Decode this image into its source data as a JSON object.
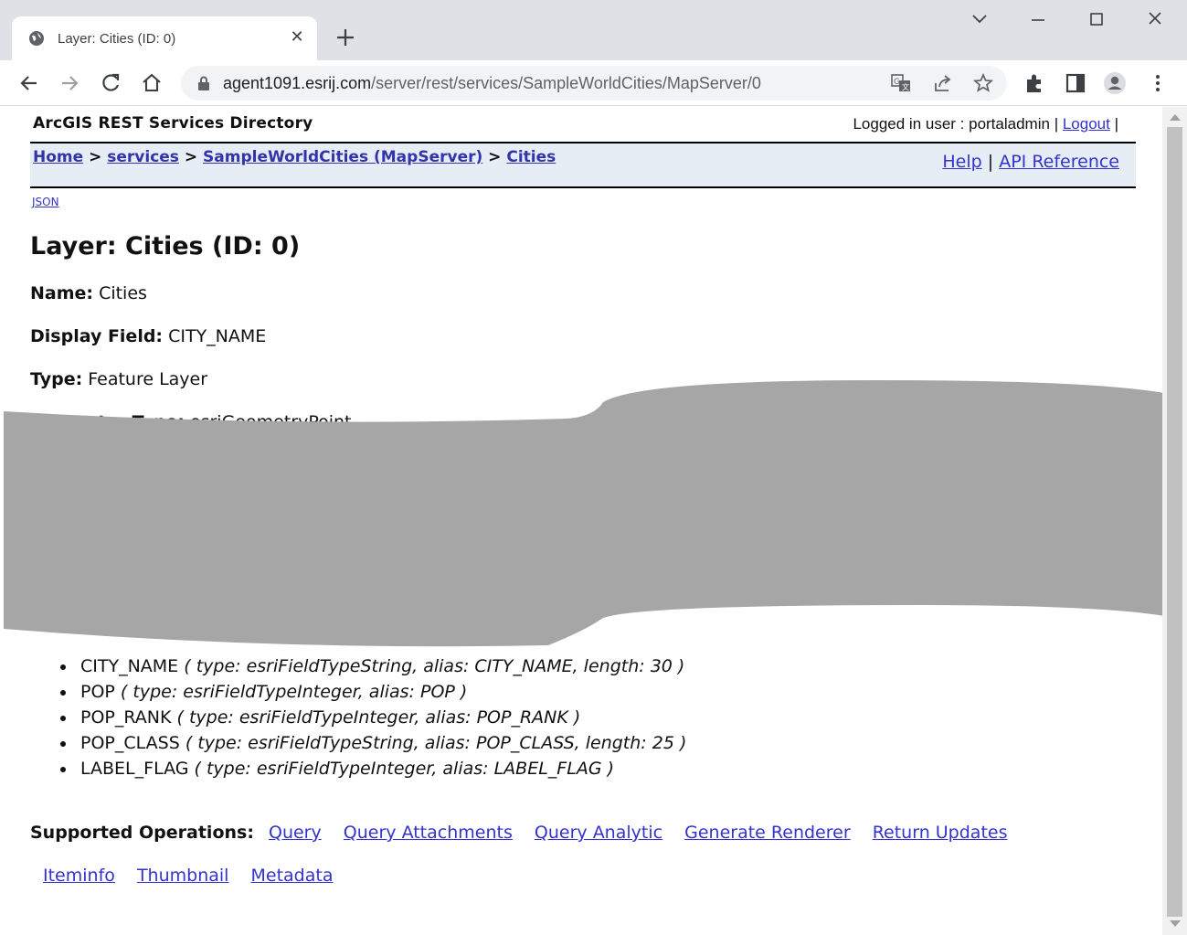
{
  "browser": {
    "tab_title": "Layer: Cities (ID: 0)",
    "url_host": "agent1091.esrij.com",
    "url_path": "/server/rest/services/SampleWorldCities/MapServer/0"
  },
  "header": {
    "directory_title": "ArcGIS REST Services Directory",
    "logged_in_label": "Logged in user : portaladmin",
    "logout_label": "Logout",
    "pipe": "|"
  },
  "breadcrumb": {
    "home": "Home",
    "services": "services",
    "mapserver": "SampleWorldCities (MapServer)",
    "layer": "Cities",
    "sep": ">"
  },
  "help_links": {
    "help": "Help",
    "api_reference": "API Reference",
    "sep": "|"
  },
  "json_link": "JSON",
  "layer": {
    "heading": "Layer: Cities (ID: 0)",
    "name_label": "Name:",
    "name_value": "Cities",
    "display_field_label": "Display Field:",
    "display_field_value": "CITY_NAME",
    "type_label": "Type:",
    "type_value": "Feature Layer",
    "geometry_type_label": "Geometry Type:",
    "geometry_type_value": "esriGeometryPoint"
  },
  "fields": [
    {
      "name": "CITY_NAME",
      "detail": "( type: esriFieldTypeString, alias: CITY_NAME, length: 30 )"
    },
    {
      "name": "POP",
      "detail": "( type: esriFieldTypeInteger, alias: POP )"
    },
    {
      "name": "POP_RANK",
      "detail": "( type: esriFieldTypeInteger, alias: POP_RANK )"
    },
    {
      "name": "POP_CLASS",
      "detail": "( type: esriFieldTypeString, alias: POP_CLASS, length: 25 )"
    },
    {
      "name": "LABEL_FLAG",
      "detail": "( type: esriFieldTypeInteger, alias: LABEL_FLAG )"
    }
  ],
  "operations": {
    "label": "Supported Operations:",
    "row1": [
      "Query",
      "Query Attachments",
      "Query Analytic",
      "Generate Renderer",
      "Return Updates"
    ],
    "row2": [
      "Iteminfo",
      "Thumbnail",
      "Metadata"
    ]
  },
  "colors": {
    "link": "#3333cc",
    "navbar_bg": "#e6edf5",
    "redaction": "#a6a6a6"
  }
}
